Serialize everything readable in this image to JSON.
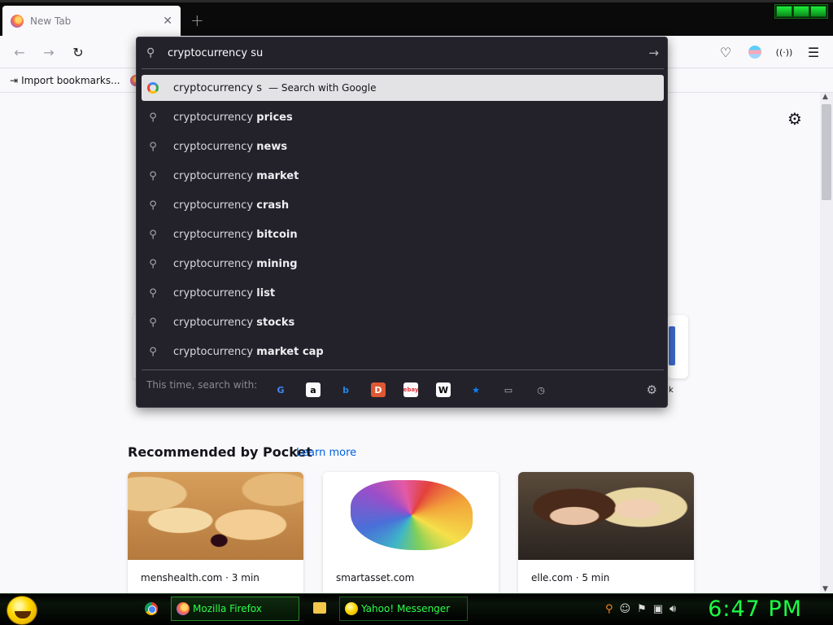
{
  "browser": {
    "tab_title": "New Tab",
    "tab_close": "✕",
    "new_tab": "+",
    "bookmarks": {
      "import_label": "Import bookmarks..."
    }
  },
  "urlbar": {
    "value": "cryptocurrency su",
    "go_icon": "→",
    "selected_result": {
      "text": "cryptocurrency s",
      "action": "— Search with Google"
    },
    "prefix": "cryptocurrency",
    "suggestions": [
      "prices",
      "news",
      "market",
      "crash",
      "bitcoin",
      "mining",
      "list",
      "stocks",
      "market cap"
    ],
    "search_with_label": "This time, search with:",
    "engines": [
      {
        "name": "google-icon",
        "glyph": "G",
        "color": "#4285f4",
        "bg": "transparent"
      },
      {
        "name": "amazon-icon",
        "glyph": "a",
        "color": "#fff",
        "bg": "#fbfbfe"
      },
      {
        "name": "bing-icon",
        "glyph": "b",
        "color": "#1e88e5",
        "bg": "transparent"
      },
      {
        "name": "duckduckgo-icon",
        "glyph": "D",
        "color": "#fff",
        "bg": "#de5833"
      },
      {
        "name": "ebay-icon",
        "glyph": "ebay",
        "color": "#e53238",
        "bg": "#fbfbfe"
      },
      {
        "name": "wikipedia-icon",
        "glyph": "W",
        "color": "#000",
        "bg": "#fbfbfe"
      },
      {
        "name": "bookmarks-star-icon",
        "glyph": "★",
        "color": "#0a84ff",
        "bg": "transparent"
      },
      {
        "name": "tabs-icon",
        "glyph": "▭",
        "color": "#b8b8c0",
        "bg": "transparent"
      },
      {
        "name": "history-icon",
        "glyph": "◷",
        "color": "#b8b8c0",
        "bg": "transparent"
      }
    ]
  },
  "newtab": {
    "topsite_partial_label": "k",
    "pocket_title": "Recommended by Pocket",
    "pocket_learn_more": "Learn more",
    "cards": [
      {
        "source": "menshealth.com · 3 min",
        "image": "donuts"
      },
      {
        "source": "smartasset.com",
        "image": "usa-map"
      },
      {
        "source": "elle.com · 5 min",
        "image": "two-women"
      }
    ]
  },
  "taskbar": {
    "tasks": [
      {
        "label": "Mozilla Firefox"
      },
      {
        "label": "Yahoo! Messenger"
      }
    ],
    "clock": "6:47 PM"
  },
  "colors": {
    "clock_green": "#1eff46",
    "urlbar_bg": "#23222b",
    "selected_row_bg": "#e3e3e6",
    "link_blue": "#0061e0"
  }
}
